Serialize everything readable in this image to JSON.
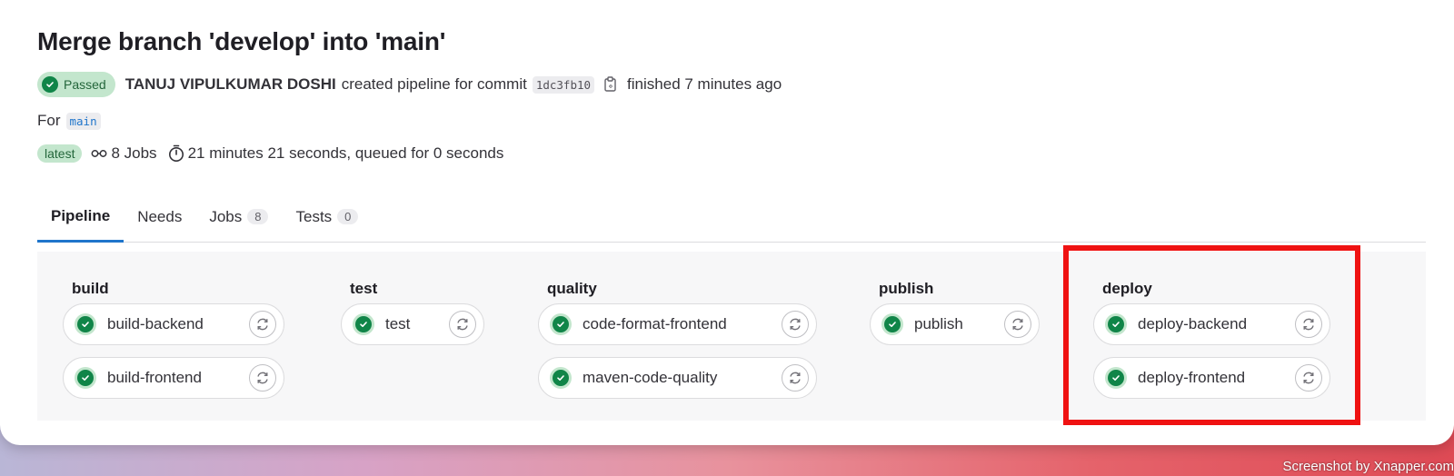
{
  "title": "Merge branch 'develop' into 'main'",
  "status_badge": "Passed",
  "author": "TANUJ VIPULKUMAR DOSHI",
  "created_text": "created pipeline for commit",
  "commit_sha": "1dc3fb10",
  "finished_text": "finished 7 minutes ago",
  "for_label": "For",
  "branch": "main",
  "latest_badge": "latest",
  "jobs_count_text": "8 Jobs",
  "duration_text": "21 minutes 21 seconds, queued for 0 seconds",
  "tabs": [
    {
      "label": "Pipeline",
      "count": null
    },
    {
      "label": "Needs",
      "count": null
    },
    {
      "label": "Jobs",
      "count": "8"
    },
    {
      "label": "Tests",
      "count": "0"
    }
  ],
  "stages": [
    {
      "name": "build",
      "jobs": [
        "build-backend",
        "build-frontend"
      ]
    },
    {
      "name": "test",
      "jobs": [
        "test"
      ]
    },
    {
      "name": "quality",
      "jobs": [
        "code-format-frontend",
        "maven-code-quality"
      ]
    },
    {
      "name": "publish",
      "jobs": [
        "publish"
      ]
    },
    {
      "name": "deploy",
      "jobs": [
        "deploy-backend",
        "deploy-frontend"
      ]
    }
  ],
  "watermark": "Screenshot by Xnapper.com",
  "colors": {
    "success": "#108548",
    "success_bg": "#c3e6cd",
    "tab_active": "#1f75cb",
    "highlight": "#ef1212"
  },
  "icons": {
    "status": "check-circle-icon",
    "copy": "clipboard-icon",
    "jobs": "pipeline-icon",
    "duration": "timer-icon",
    "retry": "retry-icon"
  }
}
